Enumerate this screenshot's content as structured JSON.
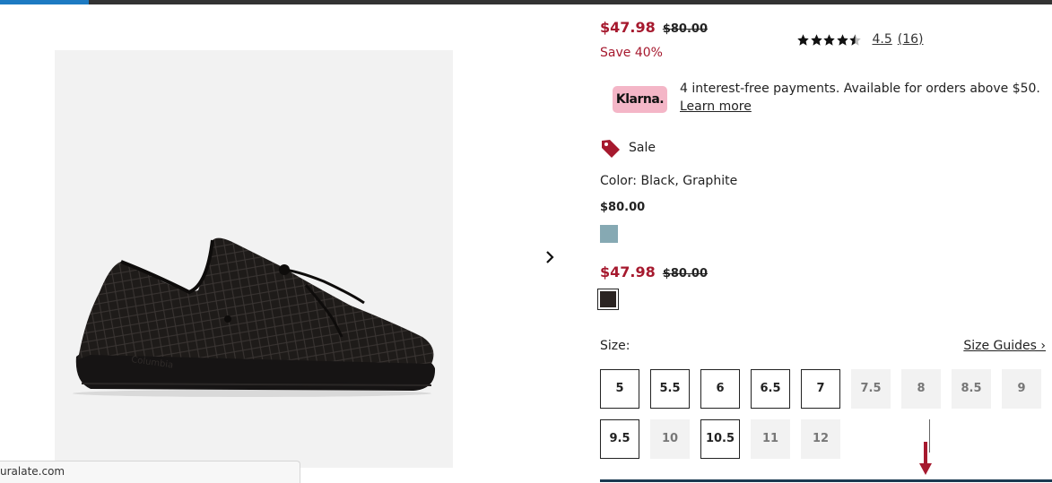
{
  "status_url": "uralate.com",
  "product": {
    "price_sale": "$47.98",
    "price_original": "$80.00",
    "save_text": "Save 40%",
    "rating_value": "4.5",
    "rating_count": "(16)",
    "rating_stars": 4.5
  },
  "klarna": {
    "badge": "Klarna.",
    "text": "4 interest-free payments. Available for orders above $50.",
    "link": "Learn more",
    "color": "#f4b6c7"
  },
  "sale_badge": {
    "label": "Sale",
    "icon": "price-tag-icon",
    "color": "#a6192e"
  },
  "color_line": "Color: Black, Graphite",
  "variants": [
    {
      "price": "$80.00",
      "swatch_color": "#86a9b3"
    },
    {
      "price_sale": "$47.98",
      "price_original": "$80.00",
      "swatch_color": "#2b2422",
      "selected": true
    }
  ],
  "size": {
    "label": "Size:",
    "guide": "Size Guides ›",
    "options": [
      {
        "label": "5",
        "available": true
      },
      {
        "label": "5.5",
        "available": true
      },
      {
        "label": "6",
        "available": true
      },
      {
        "label": "6.5",
        "available": true
      },
      {
        "label": "7",
        "available": true
      },
      {
        "label": "7.5",
        "available": false
      },
      {
        "label": "8",
        "available": false
      },
      {
        "label": "8.5",
        "available": false
      },
      {
        "label": "9",
        "available": false
      },
      {
        "label": "9.5",
        "available": true
      },
      {
        "label": "10",
        "available": false
      },
      {
        "label": "10.5",
        "available": true
      },
      {
        "label": "11",
        "available": false
      },
      {
        "label": "12",
        "available": false
      }
    ]
  },
  "colors": {
    "accent_red": "#a6192e",
    "top_bar": "#333333",
    "top_accent": "#1d7ac2"
  }
}
